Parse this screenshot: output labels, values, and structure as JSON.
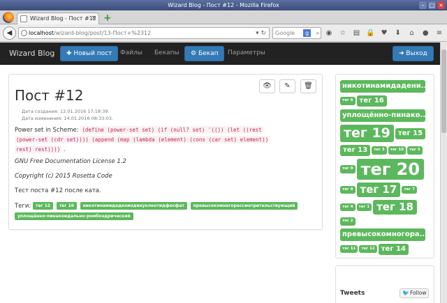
{
  "window": {
    "title": "Wizard Blog - Пост #12 - Mozilla Firefox"
  },
  "tab": {
    "title": "Wizard Blog - Пост #12",
    "close": "×",
    "new": "+"
  },
  "url": {
    "host": "localhost",
    "path": "/wizard-blog/post/13-Пост+%2312",
    "search_placeholder": "Google"
  },
  "site": {
    "brand": "Wizard Blog",
    "new_post": "Новый пост",
    "files": "Файлы",
    "backups": "Бекапы",
    "backup": "Бекап",
    "params": "Параметры",
    "logout": "Выход"
  },
  "post": {
    "title": "Пост #12",
    "created": "Дата создания: 12.01.2016 17:18:39.",
    "modified": "Дата изменения: 14.01.2016 08:33:03.",
    "power_set_prefix": "Power set in Scheme:",
    "code_line1": "(define (power-set set) (if (null? set) '(()) (let ((rest",
    "code_line2": "(power-set (cdr set)))) (append (map (lambda (element) (cons (car set) element))",
    "code_line3": "rest) rest))))",
    "code_suffix": ".",
    "license": "GNU Free Documentation License 1.2",
    "copyright": "Copyright (c) 2015 Rosetta Code",
    "after_cut": "Тест поста #12 после ката.",
    "tags_label": "Теги:",
    "tags": [
      "тег 12",
      "тег 16",
      "никотинамидадениндинуклеотидфосфат",
      "превысокомногорассмотрительствующий",
      "уплощённо-пинакоидально-ромбоэдрический"
    ]
  },
  "cloud": [
    {
      "text": "никотинамидадени...",
      "size": "l"
    },
    {
      "text": "тег 6",
      "size": "xs"
    },
    {
      "text": "тег 16",
      "size": "m"
    },
    {
      "text": "уплощённо-пинако...",
      "size": "l"
    },
    {
      "text": "тег 19",
      "size": "xl"
    },
    {
      "text": "тег 15",
      "size": "m"
    },
    {
      "text": "тег 13",
      "size": "m"
    },
    {
      "text": "тег 3",
      "size": "xs"
    },
    {
      "text": "тег 10",
      "size": "xs"
    },
    {
      "text": "тег 5",
      "size": "xs"
    },
    {
      "text": "тег 9",
      "size": "xs"
    },
    {
      "text": "тег 20",
      "size": "xxl"
    },
    {
      "text": "тег 8",
      "size": "xs"
    },
    {
      "text": "тег 17",
      "size": "lg"
    },
    {
      "text": "тег 7",
      "size": "xs"
    },
    {
      "text": "тег 4",
      "size": "xs"
    },
    {
      "text": "тег 1",
      "size": "xs"
    },
    {
      "text": "тег 18",
      "size": "lg"
    },
    {
      "text": "тег 2",
      "size": "xs"
    },
    {
      "text": "превысокомногора...",
      "size": "l"
    },
    {
      "text": "тег 11",
      "size": "xs"
    },
    {
      "text": "тег 12",
      "size": "xs"
    },
    {
      "text": "тег 14",
      "size": "m"
    }
  ],
  "tweets": {
    "title": "Tweets",
    "follow": "Follow"
  },
  "colors": {
    "primary": "#337ab7",
    "success": "#5cb85c",
    "navbar": "#222222",
    "code": "#c7254e"
  }
}
